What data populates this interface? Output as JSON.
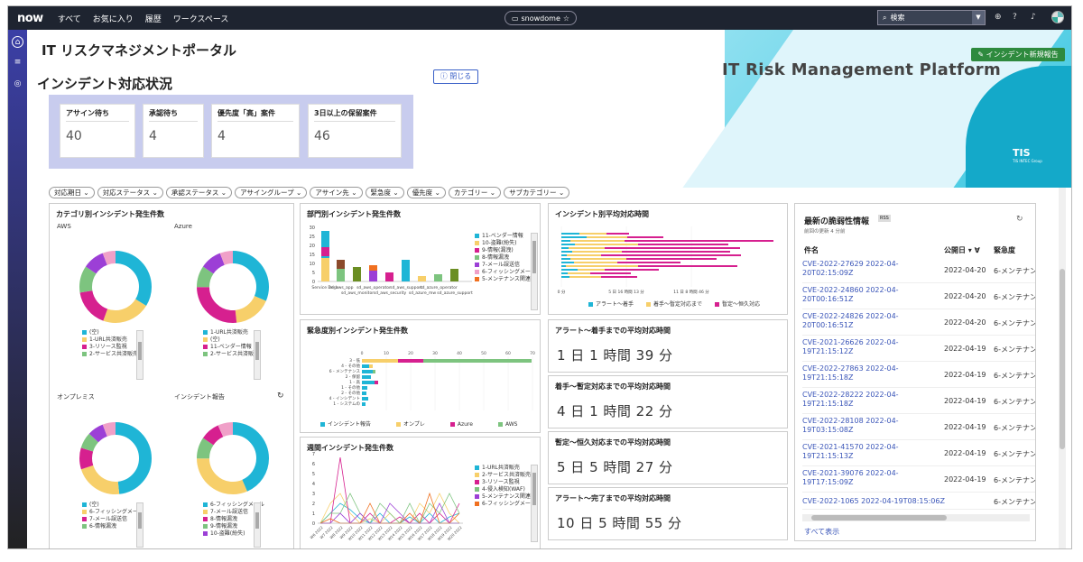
{
  "nav": {
    "logo": "now",
    "links": [
      "すべて",
      "お気に入り",
      "履歴",
      "ワークスペース"
    ],
    "instance": "snowdome",
    "search_placeholder": "検索"
  },
  "banner": {
    "portal_title": "IT リスクマネジメントポータル",
    "subtitle": "IT Risk Management Platform",
    "new_button": "インシデント新規報告",
    "brand": "TIS",
    "brand_sub": "TIS INTEC Group"
  },
  "section": {
    "title": "インシデント対応状況",
    "close_button": "閉じる"
  },
  "kpis": [
    {
      "label": "アサイン待ち",
      "value": "40"
    },
    {
      "label": "承認待ち",
      "value": "4"
    },
    {
      "label": "優先度「高」案件",
      "value": "4"
    },
    {
      "label": "3日以上の保留案件",
      "value": "46"
    }
  ],
  "filters": [
    "対応期日",
    "対応ステータス",
    "承認ステータス",
    "アサイングループ",
    "アサイン先",
    "緊急度",
    "優先度",
    "カテゴリー",
    "サブカテゴリー"
  ],
  "cat_panel": {
    "title": "カテゴリ別インシデント発生件数",
    "groups": [
      {
        "label": "AWS",
        "legend": [
          "(空)",
          "1-URL共済販売",
          "3-リソース監視",
          "2-サービス共済販売"
        ]
      },
      {
        "label": "Azure",
        "legend": [
          "1-URL共済販売",
          "(空)",
          "11-ベンダー情報",
          "2-サービス共済販売"
        ]
      },
      {
        "label": "オンプレミス",
        "legend": [
          "(空)",
          "6-フィッシングメール",
          "7-メール誤送信",
          "6-情報漏洩"
        ]
      },
      {
        "label": "インシデント報告",
        "legend": [
          "6-フィッシングメール",
          "7-メール誤送信",
          "8-情報漏洩",
          "9-情報漏洩",
          "10-盗難(紛失)"
        ]
      }
    ]
  },
  "dept_panel": {
    "title": "部門別インシデント発生件数",
    "xlabels": [
      "Service Desk",
      "sd_aws_app",
      "sd_aws_monitor",
      "sd_aws_operator",
      "sd_aws_security",
      "sd_aws_support",
      "sd_azure_mw",
      "sd_azure_operator",
      "sd_azure_support"
    ],
    "yticks": [
      "0",
      "5",
      "10",
      "15",
      "20",
      "25",
      "30"
    ],
    "legend": [
      "11-ベンダー情報",
      "10-盗難(紛失)",
      "9-情報(漏洩)",
      "8-情報漏洩",
      "7-メール誤送信",
      "6-フィッシングメール",
      "5-メンテナンス関連"
    ]
  },
  "urg_panel": {
    "title": "緊急度別インシデント発生件数",
    "ylabels": [
      "3 - 低",
      "4 - その他",
      "6 - メンテナンス",
      "2 - 保留",
      "1 - 高",
      "1 - その他",
      "2 - その他",
      "4 - インシデント",
      "1 - システムの"
    ],
    "xticks": [
      "0",
      "10",
      "20",
      "30",
      "40",
      "50",
      "60",
      "70"
    ],
    "legend": [
      "インシデント報告",
      "オンプレ",
      "Azure",
      "AWS"
    ]
  },
  "week_panel": {
    "title": "週間インシデント発生件数",
    "yticks": [
      "0",
      "1",
      "2",
      "3",
      "4",
      "5",
      "6",
      "7"
    ],
    "xlabels": [
      "W6 2022",
      "W7 2022",
      "W8 2022",
      "W9 2022",
      "W10 2022",
      "W11 2022",
      "W12 2022",
      "W13 2022",
      "W14 2022",
      "W15 2022",
      "W16 2022",
      "W17 2022",
      "W18 2022",
      "W19 2022",
      "W20 2022"
    ],
    "legend": [
      "1-URL共済販売",
      "2-サービス共済販売",
      "3-リソース監視",
      "4-侵入検知(WAF)",
      "5-メンテナンス関連",
      "6-フィッシングメール"
    ]
  },
  "avg_panel": {
    "title": "インシデント別平均対応時間",
    "xticks": [
      "0 分",
      "5 日 16 時間 13 分",
      "11 日 8 時間 46 分"
    ],
    "legend": [
      "アラート〜着手",
      "着手〜暫定対応まで",
      "暫定〜恒久対応"
    ]
  },
  "times": [
    {
      "label": "アラート〜着手までの平均対応時間",
      "value": "1 日 1 時間 39 分"
    },
    {
      "label": "着手〜暫定対応までの平均対応時間",
      "value": "4 日 1 時間 22 分"
    },
    {
      "label": "暫定〜恒久対応までの平均対応時間",
      "value": "5 日 5 時間 27 分"
    },
    {
      "label": "アラート〜完了までの平均対応時間",
      "value": "10 日 5 時間 55 分"
    }
  ],
  "vuln": {
    "title": "最新の脆弱性情報",
    "sub": "前回の更新 4 分前",
    "col_name": "件名",
    "col_date": "公開日 ▾ ∀",
    "col_sev": "緊急度",
    "show_all": "すべて表示",
    "rows": [
      {
        "name": "CVE-2022-27629 2022-04-20T02:15:09Z",
        "date": "2022-04-20",
        "sev": "6-メンテナン"
      },
      {
        "name": "CVE-2022-24860 2022-04-20T00:16:51Z",
        "date": "2022-04-20",
        "sev": "6-メンテナン"
      },
      {
        "name": "CVE-2022-24826 2022-04-20T00:16:51Z",
        "date": "2022-04-20",
        "sev": "6-メンテナン"
      },
      {
        "name": "CVE-2021-26626 2022-04-19T21:15:12Z",
        "date": "2022-04-19",
        "sev": "6-メンテナン"
      },
      {
        "name": "CVE-2022-27863 2022-04-19T21:15:18Z",
        "date": "2022-04-19",
        "sev": "6-メンテナン"
      },
      {
        "name": "CVE-2022-28222 2022-04-19T21:15:18Z",
        "date": "2022-04-19",
        "sev": "6-メンテナン"
      },
      {
        "name": "CVE-2022-28108 2022-04-19T03:15:08Z",
        "date": "2022-04-19",
        "sev": "6-メンテナン"
      },
      {
        "name": "CVE-2021-41570 2022-04-19T21:15:13Z",
        "date": "2022-04-19",
        "sev": "6-メンテナン"
      },
      {
        "name": "CVE-2021-39076 2022-04-19T17:15:09Z",
        "date": "2022-04-19",
        "sev": "6-メンテナン"
      },
      {
        "name": "CVE-2022-1065 2022-04-19T08:15:06Z",
        "date": "2022-04-19",
        "sev": "6-メンテナン"
      }
    ]
  },
  "colors": {
    "cyan": "#1fb5d6",
    "yellow": "#f7cf6a",
    "magenta": "#d6208f",
    "green": "#7dc47f",
    "purple": "#9c3fd6",
    "pink": "#f0a0c8",
    "brown": "#8b4a2b",
    "olive": "#6b8e23",
    "orange": "#f07020"
  }
}
